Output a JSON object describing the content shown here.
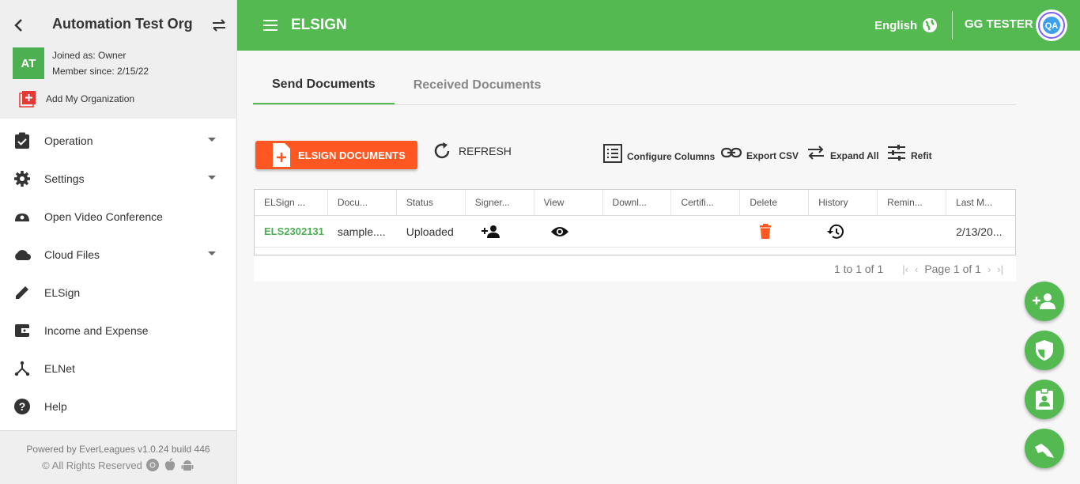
{
  "sidebar": {
    "org_title": "Automation Test Org",
    "avatar_initials": "AT",
    "joined_as": "Joined as: Owner",
    "member_since": "Member since: 2/15/22",
    "add_org_label": "Add My Organization",
    "items": [
      {
        "label": "Operation",
        "icon": "clipboard-check-icon",
        "has_caret": true
      },
      {
        "label": "Settings",
        "icon": "gear-icon",
        "has_caret": true
      },
      {
        "label": "Open Video Conference",
        "icon": "video-conference-icon",
        "has_caret": false
      },
      {
        "label": "Cloud Files",
        "icon": "cloud-icon",
        "has_caret": true
      },
      {
        "label": "ELSign",
        "icon": "pencil-icon",
        "has_caret": false
      },
      {
        "label": "Income and Expense",
        "icon": "wallet-icon",
        "has_caret": false
      },
      {
        "label": "ELNet",
        "icon": "network-icon",
        "has_caret": false
      },
      {
        "label": "Help",
        "icon": "help-icon",
        "has_caret": false
      }
    ],
    "footer_powered": "Powered by EverLeagues v1.0.24 build 446",
    "footer_rights": "© All Rights Reserved"
  },
  "topbar": {
    "title": "ELSIGN",
    "language": "English",
    "user_name": "GG TESTER",
    "user_avatar_text": "QA",
    "color": "#55b952"
  },
  "tabs": [
    {
      "label": "Send Documents",
      "active": true
    },
    {
      "label": "Received Documents",
      "active": false
    }
  ],
  "toolbar": {
    "elsign_button": "ELSIGN DOCUMENTS",
    "refresh": "REFRESH",
    "configure_columns": "Configure Columns",
    "export_csv": "Export CSV",
    "expand_all": "Expand All",
    "refit": "Refit"
  },
  "grid": {
    "columns": [
      "ELSign ...",
      "Docu...",
      "Status",
      "Signer...",
      "View",
      "Downl...",
      "Certifi...",
      "Delete",
      "History",
      "Remin...",
      "Last M..."
    ],
    "rows": [
      {
        "id": "ELS2302131",
        "document": "sample....",
        "status": "Uploaded",
        "last_modified": "2/13/20..."
      }
    ]
  },
  "pager": {
    "range": "1 to 1 of 1",
    "page": "Page 1 of 1"
  },
  "fabs": [
    "add-person-icon",
    "shield-icon",
    "badge-icon",
    "rocket-icon"
  ],
  "accent": "#fe5722"
}
